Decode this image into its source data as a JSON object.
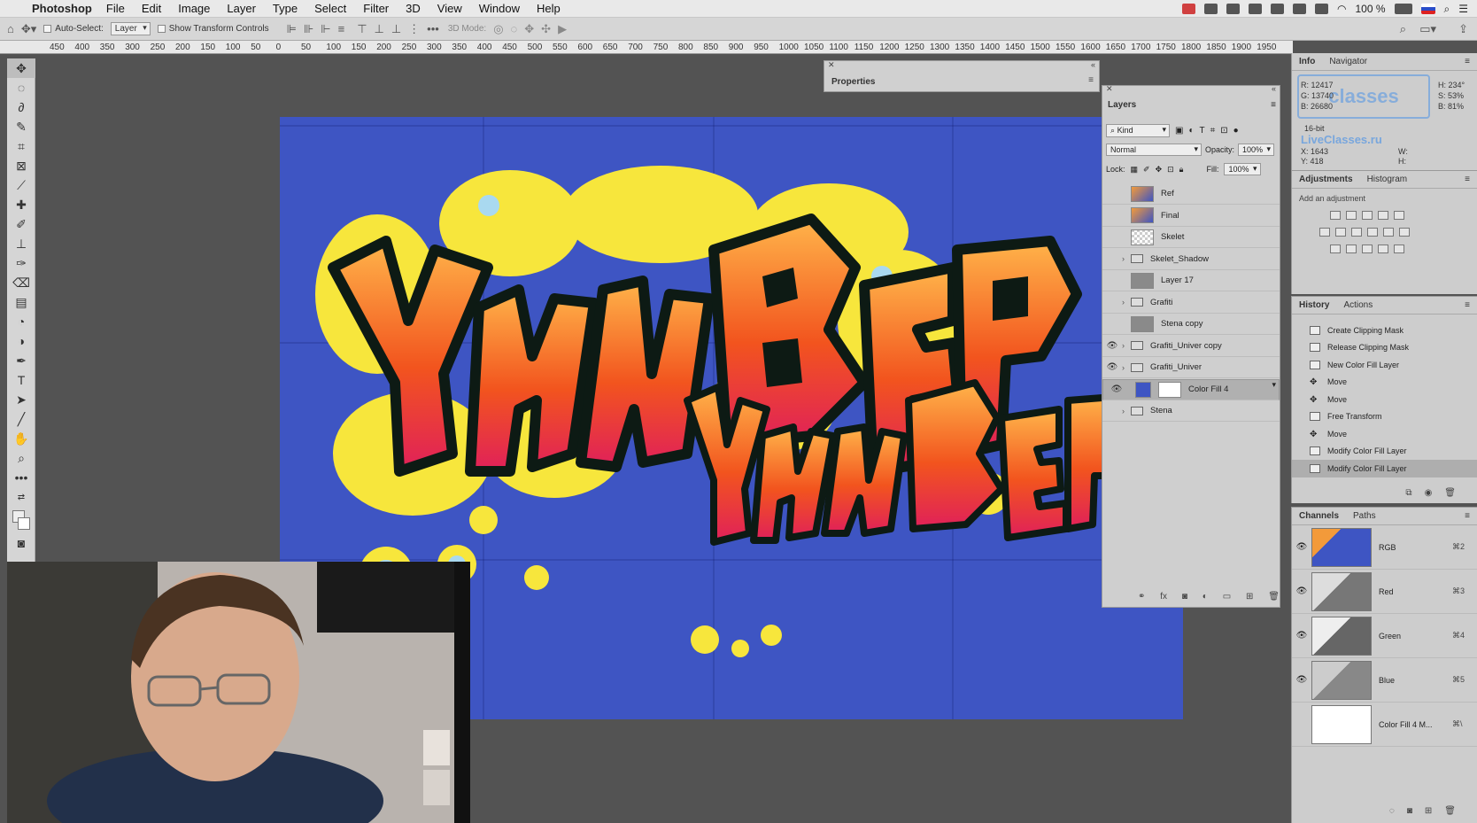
{
  "menubar": {
    "app": "Photoshop",
    "items": [
      "File",
      "Edit",
      "Image",
      "Layer",
      "Type",
      "Select",
      "Filter",
      "3D",
      "View",
      "Window",
      "Help"
    ],
    "battery": "100 %"
  },
  "options": {
    "auto_select": "Auto-Select:",
    "auto_select_value": "Layer",
    "show_transform": "Show Transform Controls",
    "mode_3d": "3D Mode:"
  },
  "ruler": {
    "ticks": [
      "450",
      "400",
      "350",
      "300",
      "250",
      "200",
      "150",
      "100",
      "50",
      "0",
      "50",
      "100",
      "150",
      "200",
      "250",
      "300",
      "350",
      "400",
      "450",
      "500",
      "550",
      "600",
      "650",
      "700",
      "750",
      "800",
      "850",
      "900",
      "950",
      "1000",
      "1050",
      "1100",
      "1150",
      "1200",
      "1250",
      "1300",
      "1350",
      "1400",
      "1450",
      "1500",
      "1550",
      "1600",
      "1650",
      "1700",
      "1750",
      "1800",
      "1850",
      "1900",
      "1950"
    ]
  },
  "properties": {
    "title": "Properties"
  },
  "layers": {
    "title": "Layers",
    "kind": "Kind",
    "blend_mode": "Normal",
    "opacity_label": "Opacity:",
    "opacity": "100%",
    "lock_label": "Lock:",
    "fill_label": "Fill:",
    "fill": "100%",
    "rows": [
      {
        "name": "Ref",
        "type": "image",
        "visible": false
      },
      {
        "name": "Final",
        "type": "image",
        "visible": false
      },
      {
        "name": "Skelet",
        "type": "transparent",
        "visible": false
      },
      {
        "name": "Skelet_Shadow",
        "type": "group",
        "visible": false
      },
      {
        "name": "Layer 17",
        "type": "gray",
        "visible": false
      },
      {
        "name": "Grafiti",
        "type": "group",
        "visible": false
      },
      {
        "name": "Stena copy",
        "type": "gray",
        "visible": false
      },
      {
        "name": "Grafiti_Univer copy",
        "type": "group",
        "visible": true
      },
      {
        "name": "Grafiti_Univer",
        "type": "group",
        "visible": true
      },
      {
        "name": "Color Fill 4",
        "type": "fill",
        "visible": true
      },
      {
        "name": "Stena",
        "type": "group",
        "visible": false
      }
    ],
    "selected": "Color Fill 4"
  },
  "info": {
    "tabs": [
      "Info",
      "Navigator"
    ],
    "r_label": "R:",
    "r": "12417",
    "g_label": "G:",
    "g": "13740",
    "b_label": "B:",
    "b": "26680",
    "h_label": "H:",
    "h": "234°",
    "s_label": "S:",
    "s": "53%",
    "bv_label": "B:",
    "bv": "81%",
    "bitdepth": "16-bit",
    "x_label": "X:",
    "x": "1643",
    "y_label": "Y:",
    "y": "418",
    "w_label": "W:",
    "h2_label": "H:",
    "watermark": "LiveClasses.ru",
    "watermark_logo": "classes"
  },
  "adjustments": {
    "tabs": [
      "Adjustments",
      "Histogram"
    ],
    "hint": "Add an adjustment"
  },
  "history": {
    "tabs": [
      "History",
      "Actions"
    ],
    "items": [
      "Create Clipping Mask",
      "Release Clipping Mask",
      "New Color Fill Layer",
      "Move",
      "Move",
      "Free Transform",
      "Move",
      "Modify Color Fill Layer",
      "Modify Color Fill Layer"
    ],
    "item_icons": [
      "doc",
      "doc",
      "doc",
      "move",
      "move",
      "doc",
      "move",
      "doc",
      "doc"
    ]
  },
  "channels": {
    "tabs": [
      "Channels",
      "Paths"
    ],
    "rows": [
      {
        "name": "RGB",
        "key": "⌘2"
      },
      {
        "name": "Red",
        "key": "⌘3"
      },
      {
        "name": "Green",
        "key": "⌘4"
      },
      {
        "name": "Blue",
        "key": "⌘5"
      },
      {
        "name": "Color Fill 4 M...",
        "key": "⌘\\"
      }
    ]
  },
  "canvas": {
    "graffiti_main": "YHUBEP",
    "graffiti_small": "YHUBEP",
    "wall_color": "#3e55c3"
  }
}
